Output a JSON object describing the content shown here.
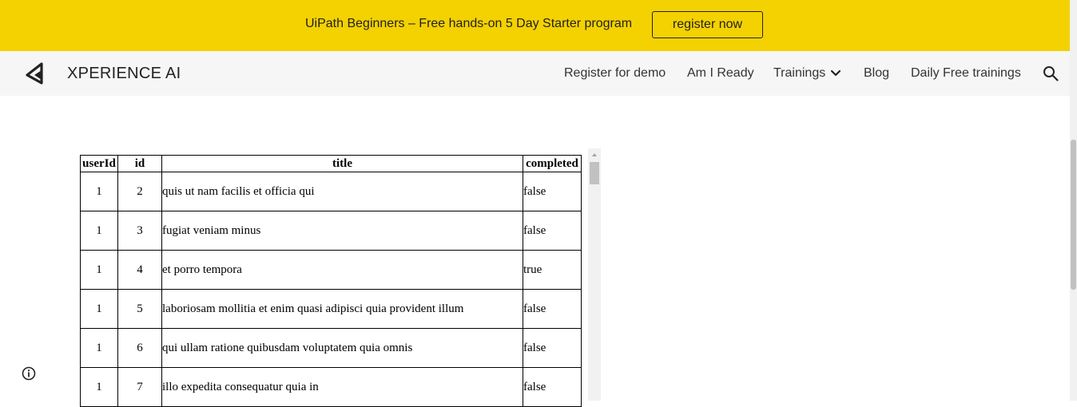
{
  "banner": {
    "text": "UiPath Beginners – Free hands-on 5 Day Starter program",
    "button_label": "register now",
    "color": "#f4d100"
  },
  "nav": {
    "brand": "XPERIENCE AI",
    "logo_icon": "xperience-logo-icon",
    "links": [
      "Register for demo",
      "Am I Ready",
      "Trainings",
      "Blog",
      "Daily Free trainings"
    ],
    "dropdown_icon": "chevron-down-icon",
    "search_icon": "search-icon"
  },
  "table": {
    "headers": [
      "userId",
      "id",
      "title",
      "completed"
    ],
    "rows": [
      [
        "1",
        "2",
        "quis ut nam facilis et officia qui",
        "false"
      ],
      [
        "1",
        "3",
        "fugiat veniam minus",
        "false"
      ],
      [
        "1",
        "4",
        "et porro tempora",
        "true"
      ],
      [
        "1",
        "5",
        "laboriosam mollitia et enim quasi adipisci quia provident illum",
        "false"
      ],
      [
        "1",
        "6",
        "qui ullam ratione quibusdam voluptatem quia omnis",
        "false"
      ],
      [
        "1",
        "7",
        "illo expedita consequatur quia in",
        "false"
      ]
    ]
  },
  "info_icon": "info-icon"
}
